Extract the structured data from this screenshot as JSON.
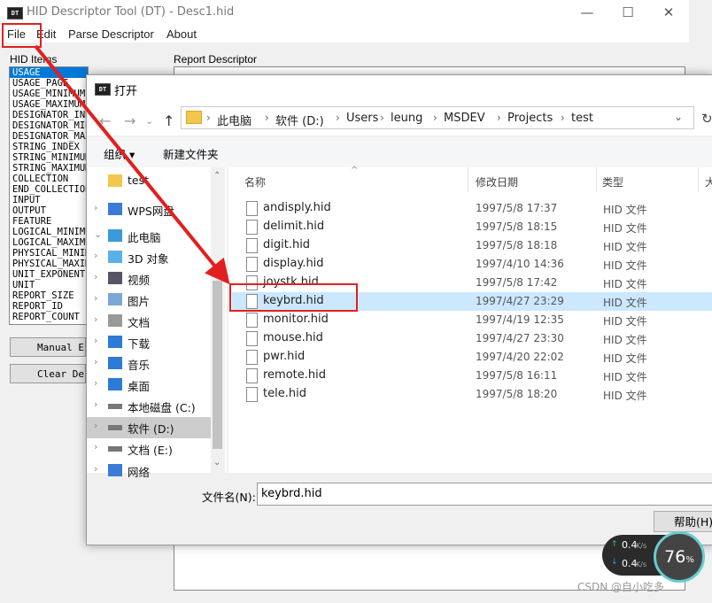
{
  "app": {
    "title": "HID Descriptor Tool (DT) - Desc1.hid",
    "icon_text": "DT",
    "window_controls": {
      "minimize": "—",
      "maximize": "☐",
      "close": "✕"
    },
    "menu": [
      "File",
      "Edit",
      "Parse Descriptor",
      "About"
    ],
    "hid_items_label": "HID Items",
    "report_label": "Report Descriptor",
    "hid_items": [
      "USAGE",
      "USAGE_PAGE",
      "USAGE_MINIMUM",
      "USAGE_MAXIMUM",
      "DESIGNATOR_INDEX",
      "DESIGNATOR_MINIMUM",
      "DESIGNATOR_MAXIMUM",
      "STRING_INDEX",
      "STRING_MINIMUM",
      "STRING_MAXIMUM",
      "COLLECTION",
      "END_COLLECTION",
      "INPUT",
      "OUTPUT",
      "FEATURE",
      "LOGICAL_MINIMUM",
      "LOGICAL_MAXIMUM",
      "PHYSICAL_MINIMUM",
      "PHYSICAL_MAXIMUM",
      "UNIT_EXPONENT",
      "UNIT",
      "REPORT_SIZE",
      "REPORT_ID",
      "REPORT_COUNT"
    ],
    "selected_item": "USAGE",
    "buttons": {
      "manual": "Manual Entry",
      "clear": "Clear Descriptor"
    }
  },
  "dialog": {
    "title": "打开",
    "breadcrumbs": [
      "此电脑",
      "软件 (D:)",
      "Users",
      "leung",
      "MSDEV",
      "Projects",
      "test"
    ],
    "commands": {
      "organize": "组织 ▾",
      "new_folder": "新建文件夹"
    },
    "nav_items": [
      {
        "label": "test",
        "icon": "folder-icon",
        "chevron": ""
      },
      {
        "label": "WPS网盘",
        "icon": "cloud-icon",
        "chevron": "›"
      },
      {
        "label": "此电脑",
        "icon": "computer-icon",
        "chevron": "⌄"
      },
      {
        "label": "3D 对象",
        "icon": "cube-icon",
        "chevron": "›"
      },
      {
        "label": "视频",
        "icon": "video-icon",
        "chevron": "›"
      },
      {
        "label": "图片",
        "icon": "picture-icon",
        "chevron": "›"
      },
      {
        "label": "文档",
        "icon": "document-icon",
        "chevron": "›"
      },
      {
        "label": "下载",
        "icon": "download-icon",
        "chevron": "›"
      },
      {
        "label": "音乐",
        "icon": "music-icon",
        "chevron": "›"
      },
      {
        "label": "桌面",
        "icon": "desktop-icon",
        "chevron": "›"
      },
      {
        "label": "本地磁盘 (C:)",
        "icon": "drive-icon",
        "chevron": "›"
      },
      {
        "label": "软件 (D:)",
        "icon": "drive-icon",
        "chevron": "›"
      },
      {
        "label": "文档 (E:)",
        "icon": "drive-icon",
        "chevron": "›"
      },
      {
        "label": "网络",
        "icon": "network-icon",
        "chevron": "›"
      }
    ],
    "selected_nav": "软件 (D:)",
    "columns": {
      "name": "名称",
      "date": "修改日期",
      "type": "类型",
      "size": "大"
    },
    "files": [
      {
        "name": "andisply.hid",
        "date": "1997/5/8 17:37",
        "type": "HID 文件"
      },
      {
        "name": "delimit.hid",
        "date": "1997/5/8 18:15",
        "type": "HID 文件"
      },
      {
        "name": "digit.hid",
        "date": "1997/5/8 18:18",
        "type": "HID 文件"
      },
      {
        "name": "display.hid",
        "date": "1997/4/10 14:36",
        "type": "HID 文件"
      },
      {
        "name": "joystk.hid",
        "date": "1997/5/8 17:42",
        "type": "HID 文件"
      },
      {
        "name": "keybrd.hid",
        "date": "1997/4/27 23:29",
        "type": "HID 文件"
      },
      {
        "name": "monitor.hid",
        "date": "1997/4/19 12:35",
        "type": "HID 文件"
      },
      {
        "name": "mouse.hid",
        "date": "1997/4/27 23:30",
        "type": "HID 文件"
      },
      {
        "name": "pwr.hid",
        "date": "1997/4/20 22:02",
        "type": "HID 文件"
      },
      {
        "name": "remote.hid",
        "date": "1997/5/8 16:11",
        "type": "HID 文件"
      },
      {
        "name": "tele.hid",
        "date": "1997/5/8 18:20",
        "type": "HID 文件"
      }
    ],
    "selected_file": "keybrd.hid",
    "filename_label": "文件名(N):",
    "filename_value": "keybrd.hid",
    "help_button": "帮助(H)"
  },
  "overlay": {
    "upload_speed": "0.4",
    "download_speed": "0.4",
    "speed_unit": "K/s",
    "cpu_percent": "76",
    "percent_sign": "%",
    "watermark": "CSDN @自小吃多"
  },
  "colors": {
    "annotation": "#e02020",
    "selection": "#cce8ff",
    "list_selection": "#0078d7"
  }
}
